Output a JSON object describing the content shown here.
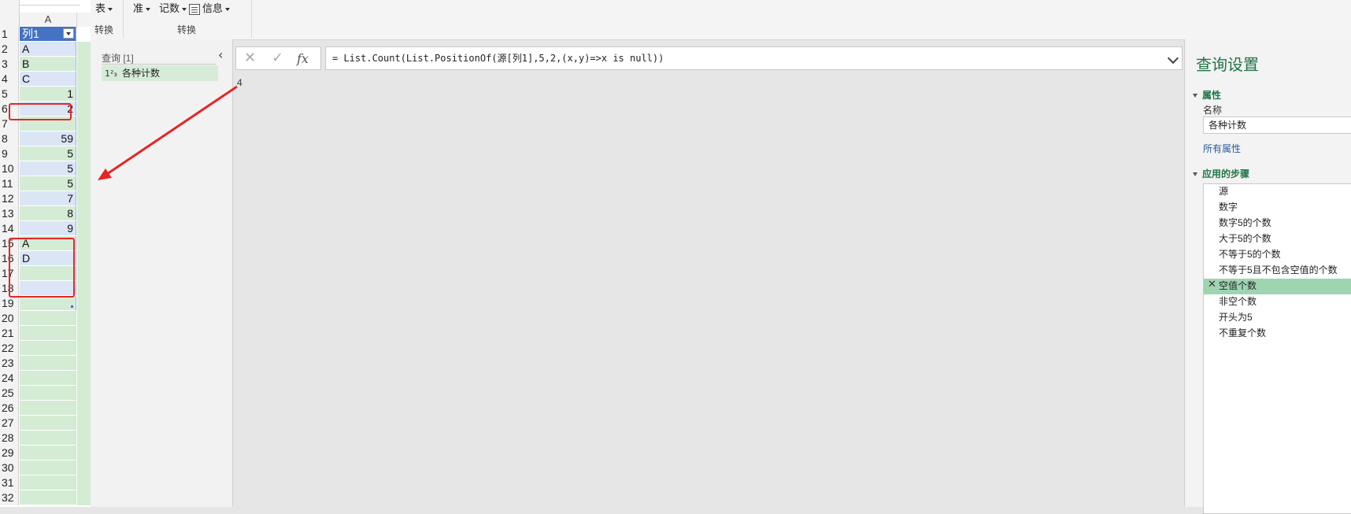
{
  "sheet": {
    "column_header": "A",
    "header_cell": "列1",
    "rows": [
      {
        "n": "1",
        "v": "列1"
      },
      {
        "n": "2",
        "v": "A"
      },
      {
        "n": "3",
        "v": "B"
      },
      {
        "n": "4",
        "v": "C"
      },
      {
        "n": "5",
        "v": "1"
      },
      {
        "n": "6",
        "v": "2"
      },
      {
        "n": "7",
        "v": ""
      },
      {
        "n": "8",
        "v": "59"
      },
      {
        "n": "9",
        "v": "5"
      },
      {
        "n": "10",
        "v": "5"
      },
      {
        "n": "11",
        "v": "5"
      },
      {
        "n": "12",
        "v": "7"
      },
      {
        "n": "13",
        "v": "8"
      },
      {
        "n": "14",
        "v": "9"
      },
      {
        "n": "15",
        "v": "A"
      },
      {
        "n": "16",
        "v": "D"
      },
      {
        "n": "17",
        "v": ""
      },
      {
        "n": "18",
        "v": ""
      },
      {
        "n": "19",
        "v": ""
      },
      {
        "n": "20",
        "v": ""
      },
      {
        "n": "21",
        "v": ""
      },
      {
        "n": "22",
        "v": ""
      },
      {
        "n": "23",
        "v": ""
      },
      {
        "n": "24",
        "v": ""
      },
      {
        "n": "25",
        "v": ""
      },
      {
        "n": "26",
        "v": ""
      },
      {
        "n": "27",
        "v": ""
      },
      {
        "n": "28",
        "v": ""
      },
      {
        "n": "29",
        "v": ""
      },
      {
        "n": "30",
        "v": ""
      },
      {
        "n": "31",
        "v": ""
      },
      {
        "n": "32",
        "v": ""
      }
    ]
  },
  "ribbon": {
    "btn_table": "表",
    "btn_standard": "准",
    "btn_count": "记数",
    "btn_info": "信息",
    "group1": "转换",
    "group2": "转换"
  },
  "queries": {
    "title": "查询 [1]",
    "item_type": "1²₃",
    "item_name": "各种计数"
  },
  "formula": {
    "text": "= List.Count(List.PositionOf(源[列1],5,2,(x,y)=>x is null))",
    "cancel_icon": "✕",
    "commit_icon": "✓",
    "fx_label": "fx"
  },
  "result": {
    "value": "4"
  },
  "settings": {
    "title": "查询设置",
    "properties_header": "属性",
    "name_label": "名称",
    "name_value": "各种计数",
    "all_properties": "所有属性",
    "steps_header": "应用的步骤",
    "steps": [
      "源",
      "数字",
      "数字5的个数",
      "大于5的个数",
      "不等于5的个数",
      "不等于5且不包含空值的个数",
      "空值个数",
      "非空个数",
      "开头为5",
      "不重复个数"
    ],
    "active_step": "空值个数",
    "active_color": "#9fd4b1"
  },
  "colors": {
    "accent_green": "#217346",
    "annotation_red": "#e52626",
    "table_header_blue": "#4472c4"
  }
}
